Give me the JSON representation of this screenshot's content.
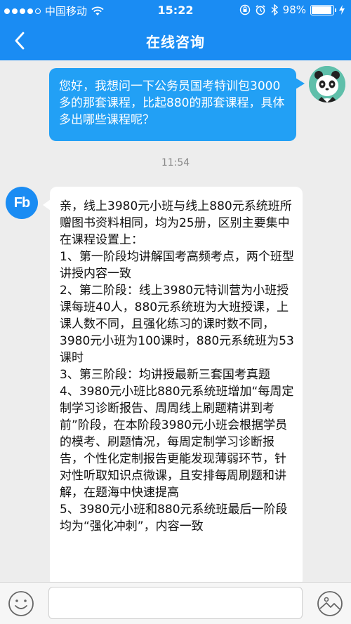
{
  "status_bar": {
    "carrier": "中国移动",
    "time": "15:22",
    "battery_text": "98%",
    "battery_level": 0.98,
    "signal_full": 4,
    "signal_total": 5
  },
  "nav": {
    "title": "在线咨询",
    "back_icon": "chevron-left-icon"
  },
  "chat": {
    "user_message": "您好，我想问一下公务员国考特训包3000多的那套课程，比起880的那套课程，具体多出哪些课程呢？",
    "timestamp": "11:54",
    "agent_avatar_text": "Fb",
    "agent_message_lines": [
      "亲，线上3980元小班与线上880元系统班所赠图书资料相同，均为25册，区别主要集中在课程设置上：",
      "1、第一阶段均讲解国考高频考点，两个班型讲授内容一致",
      "2、第二阶段：线上3980元特训营为小班授课每班40人，880元系统班为大班授课，上课人数不同，且强化练习的课时数不同，3980元小班为100课时，880元系统班为53课时",
      "3、第三阶段：均讲授最新三套国考真题",
      "4、3980元小班比880元系统班增加“每周定制学习诊断报告、周周线上刷题精讲到考前”阶段，在本阶段3980元小班会根据学员的模考、刷题情况，每周定制学习诊断报告，个性化定制报告更能发现薄弱环节，针对性听取知识点微课，且安排每周刷题和讲解，在题海中快速提高",
      "5、3980元小班和880元系统班最后一阶段均为“强化冲刺”，内容一致"
    ]
  },
  "input_bar": {
    "emoji_icon": "emoji-smile-icon",
    "input_value": "",
    "image_icon": "image-picture-icon"
  },
  "colors": {
    "brand_blue": "#1a8cf3",
    "user_bubble": "#22a0f5",
    "chat_bg": "#ededed"
  }
}
